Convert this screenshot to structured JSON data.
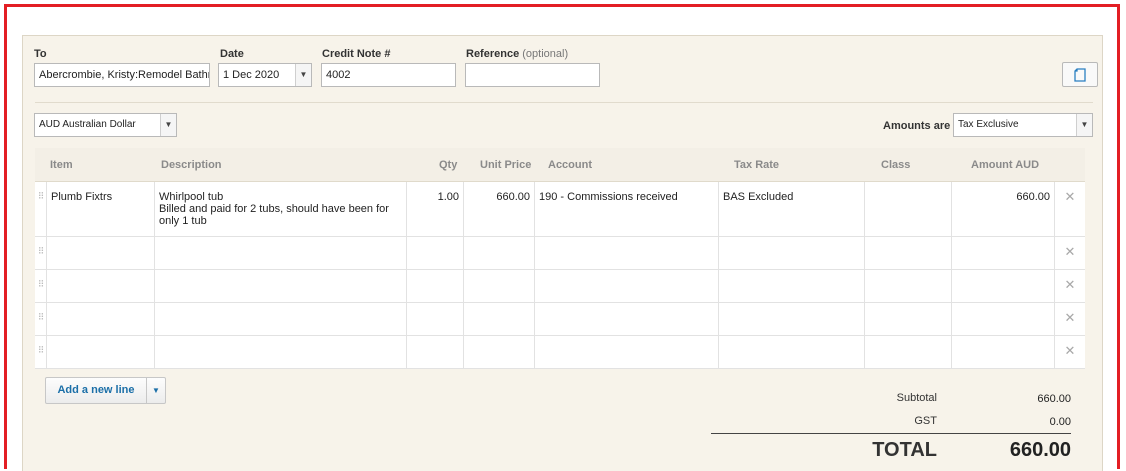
{
  "header": {
    "to_label": "To",
    "to_value": "Abercrombie, Kristy:Remodel Bathroom",
    "date_label": "Date",
    "date_value": "1 Dec 2020",
    "credit_note_label": "Credit Note #",
    "credit_note_value": "4002",
    "reference_label": "Reference",
    "reference_optional": "(optional)",
    "reference_value": ""
  },
  "currency": {
    "value": "AUD Australian Dollar"
  },
  "amounts": {
    "label": "Amounts are",
    "value": "Tax Exclusive"
  },
  "table": {
    "columns": [
      "Item",
      "Description",
      "Qty",
      "Unit Price",
      "Account",
      "Tax Rate",
      "Class",
      "Amount AUD"
    ],
    "rows": [
      {
        "item": "Plumb Fixtrs",
        "description": "Whirlpool tub\nBilled and paid for 2 tubs, should have been for only 1 tub",
        "qty": "1.00",
        "unit_price": "660.00",
        "account": "190 - Commissions received",
        "tax_rate": "BAS Excluded",
        "class": "",
        "amount": "660.00"
      },
      {
        "item": "",
        "description": "",
        "qty": "",
        "unit_price": "",
        "account": "",
        "tax_rate": "",
        "class": "",
        "amount": ""
      },
      {
        "item": "",
        "description": "",
        "qty": "",
        "unit_price": "",
        "account": "",
        "tax_rate": "",
        "class": "",
        "amount": ""
      },
      {
        "item": "",
        "description": "",
        "qty": "",
        "unit_price": "",
        "account": "",
        "tax_rate": "",
        "class": "",
        "amount": ""
      },
      {
        "item": "",
        "description": "",
        "qty": "",
        "unit_price": "",
        "account": "",
        "tax_rate": "",
        "class": "",
        "amount": ""
      }
    ]
  },
  "add_line": {
    "label": "Add a new line"
  },
  "totals": {
    "subtotal_label": "Subtotal",
    "subtotal_value": "660.00",
    "gst_label": "GST",
    "gst_value": "0.00",
    "total_label": "TOTAL",
    "total_value": "660.00"
  },
  "icons": {
    "handle": "drag-handle-icon",
    "delete": "close-icon",
    "copy": "copy-icon",
    "dropdown": "chevron-down-icon"
  },
  "colors": {
    "highlight_border": "#e31e24",
    "panel_bg": "#f7f3ea",
    "link_blue": "#1b6fa8"
  }
}
